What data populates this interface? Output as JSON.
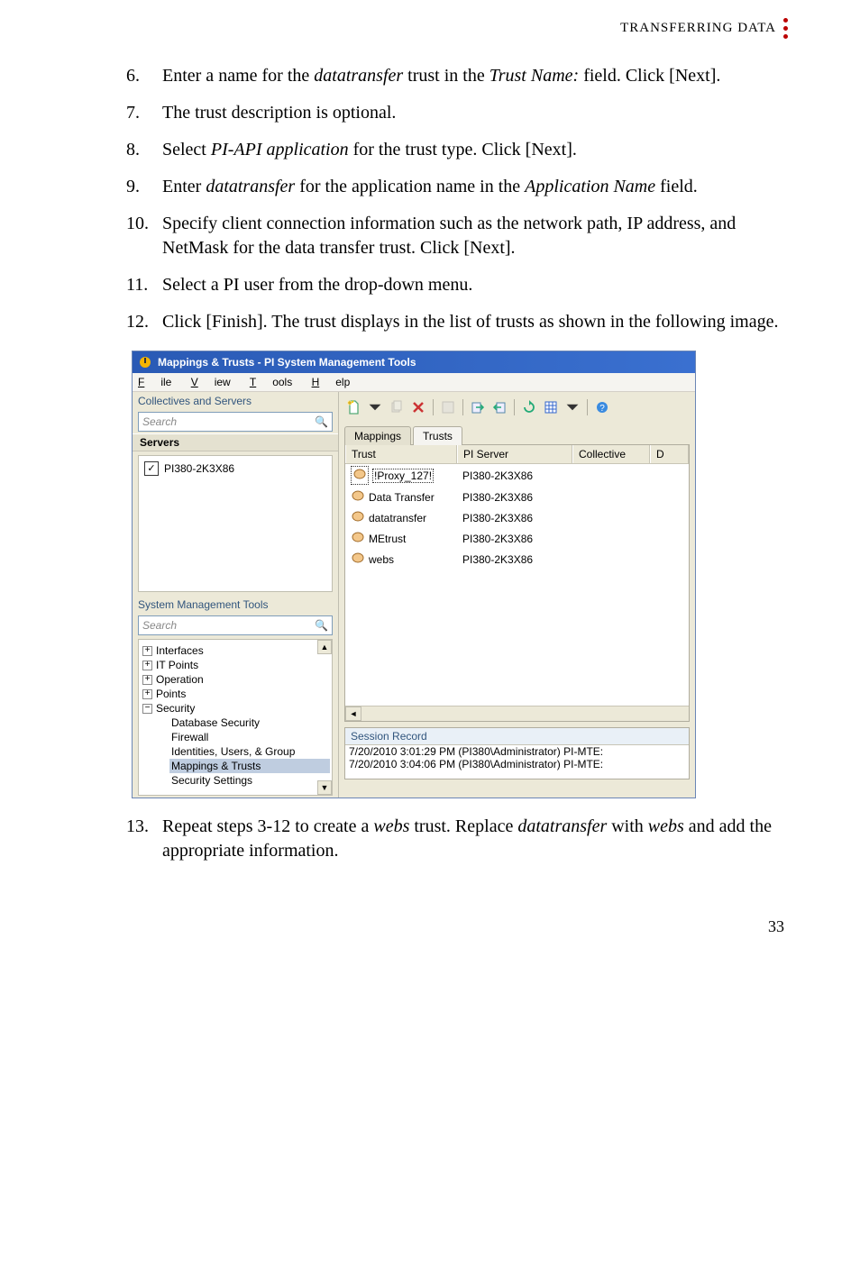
{
  "header": {
    "section": "TRANSFERRING DATA"
  },
  "steps": {
    "s6a": "Enter a name for the ",
    "s6b": "datatransfer",
    "s6c": " trust in the ",
    "s6d": "Trust Name:",
    "s6e": " field. Click [Next].",
    "s7": "The trust description is optional.",
    "s8a": "Select ",
    "s8b": "PI-API application",
    "s8c": " for the trust type. Click [Next].",
    "s9a": "Enter ",
    "s9b": "datatransfer",
    "s9c": " for the application name in the ",
    "s9d": "Application Name",
    "s9e": " field.",
    "s10": "Specify client connection information such as the network path, IP address, and NetMask for the data transfer trust. Click [Next].",
    "s11": "Select a PI user from the drop-down menu.",
    "s12": "Click [Finish]. The trust displays in the list of trusts as shown in the following image.",
    "s13a": "Repeat steps 3-12 to create a ",
    "s13b": "webs",
    "s13c": " trust. Replace ",
    "s13d": "datatransfer",
    "s13e": " with ",
    "s13f": "webs",
    "s13g": " and add the appropriate information."
  },
  "window": {
    "title": "Mappings & Trusts - PI System Management Tools",
    "menus": {
      "file": "File",
      "view": "View",
      "tools": "Tools",
      "help": "Help"
    },
    "left": {
      "collectives_label": "Collectives and Servers",
      "search_placeholder": "Search",
      "servers_label": "Servers",
      "server_item": "PI380-2K3X86",
      "smt_label": "System Management Tools",
      "tree": {
        "interfaces": "Interfaces",
        "itpoints": "IT Points",
        "operation": "Operation",
        "points": "Points",
        "security": "Security",
        "db_security": "Database Security",
        "firewall": "Firewall",
        "ident": "Identities, Users, & Group",
        "mappings": "Mappings & Trusts",
        "sec_settings": "Security Settings"
      }
    },
    "tabs": {
      "mappings": "Mappings",
      "trusts": "Trusts"
    },
    "columns": {
      "trust": "Trust",
      "piserver": "PI Server",
      "collective": "Collective",
      "d": "D"
    },
    "rows": [
      {
        "trust": "!Proxy_127!",
        "server": "PI380-2K3X86"
      },
      {
        "trust": "Data Transfer",
        "server": "PI380-2K3X86"
      },
      {
        "trust": "datatransfer",
        "server": "PI380-2K3X86"
      },
      {
        "trust": "MEtrust",
        "server": "PI380-2K3X86"
      },
      {
        "trust": "webs",
        "server": "PI380-2K3X86"
      }
    ],
    "session": {
      "label": "Session Record",
      "line1": "7/20/2010 3:01:29 PM (PI380\\Administrator) PI-MTE:",
      "line2": "7/20/2010 3:04:06 PM (PI380\\Administrator) PI-MTE:"
    }
  },
  "page_number": "33"
}
